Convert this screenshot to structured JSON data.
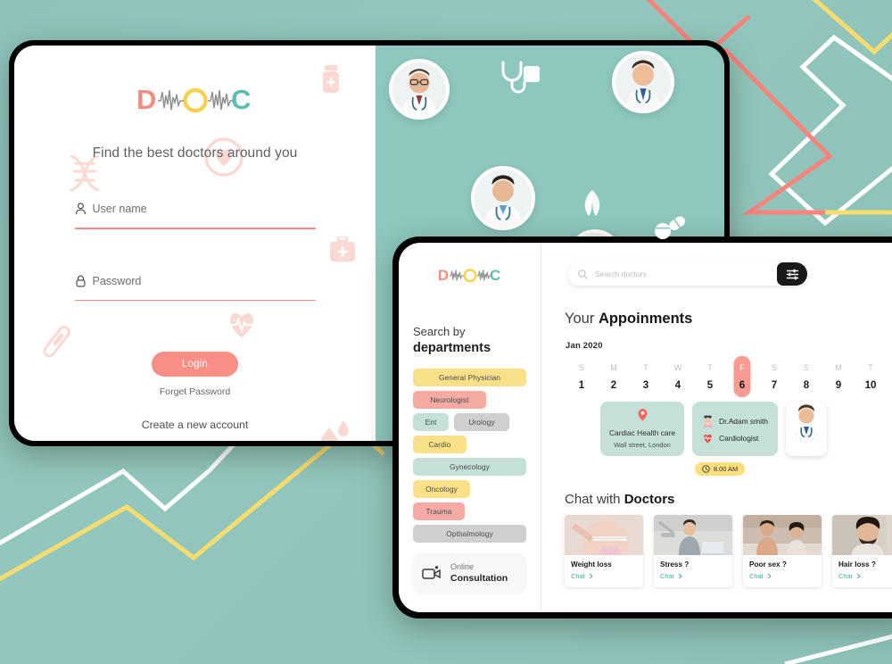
{
  "brand": {
    "name": "DOC",
    "letters": [
      "D",
      "O",
      "C"
    ],
    "colors": {
      "d": "#f08e86",
      "o": "#f7d14e",
      "c": "#5fbfae",
      "wave": "#8d9093"
    }
  },
  "login": {
    "tagline": "Find the best doctors around you",
    "username": {
      "label": "User name",
      "value": "",
      "icon": "user-icon"
    },
    "password": {
      "label": "Password",
      "value": "",
      "icon": "lock-icon"
    },
    "login_button": "Login",
    "forget_password": "Forget Password",
    "create_account": "Create a new account",
    "accent_color": "#f98e85",
    "panel_color": "#8ec7bd",
    "decor_icons": [
      "pill-bottle-icon",
      "dna-icon",
      "heart-cross-icon",
      "first-aid-kit-icon",
      "heart-pulse-icon",
      "thermometer-icon",
      "blood-drop-icon"
    ],
    "teal_decor_icons": [
      "stethoscope-icon",
      "pills-icon",
      "leaf-icon"
    ]
  },
  "dashboard": {
    "sidebar": {
      "search_by": "Search by",
      "departments_label": "departments",
      "departments": [
        {
          "label": "General Physician",
          "color": "#fbe08a",
          "width": "full"
        },
        {
          "label": "Neurologist",
          "color": "#f6aaa4",
          "width": "wide"
        },
        {
          "label": "Ent",
          "color": "#c4e0d9",
          "width": "narrow"
        },
        {
          "label": "Urology",
          "color": "#cfcfcf",
          "width": "mid"
        },
        {
          "label": "Cardio",
          "color": "#fbe08a",
          "width": "mid"
        },
        {
          "label": "Gynecology",
          "color": "#c4e0d9",
          "width": "full"
        },
        {
          "label": "Oncology",
          "color": "#fbe08a",
          "width": "mid"
        },
        {
          "label": "Trauma",
          "color": "#f6aaa4",
          "width": "mid"
        },
        {
          "label": "Opthalmology",
          "color": "#cfcfcf",
          "width": "full"
        }
      ],
      "online_consultation": {
        "line1": "Online",
        "line2": "Consultation",
        "icon": "video-camera-icon"
      }
    },
    "search": {
      "placeholder": "Search doctors",
      "value": "",
      "icon": "search-icon",
      "filter_icon": "filter-sliders-icon",
      "filter_bg": "#17191b"
    },
    "appointments": {
      "title_light": "Your ",
      "title_bold": "Appoinments",
      "month": "Jan 2020",
      "days": [
        {
          "dow": "S",
          "num": "1",
          "active": false
        },
        {
          "dow": "M",
          "num": "2",
          "active": false
        },
        {
          "dow": "T",
          "num": "3",
          "active": false
        },
        {
          "dow": "W",
          "num": "4",
          "active": false
        },
        {
          "dow": "T",
          "num": "5",
          "active": false
        },
        {
          "dow": "F",
          "num": "6",
          "active": true
        },
        {
          "dow": "S",
          "num": "7",
          "active": false
        },
        {
          "dow": "S",
          "num": "8",
          "active": false
        },
        {
          "dow": "M",
          "num": "9",
          "active": false
        },
        {
          "dow": "T",
          "num": "10",
          "active": false
        }
      ],
      "active_color": "#f99b92",
      "clinic": {
        "name": "Cardiac Health care",
        "address": "Wall street, London",
        "icon": "location-pin-icon"
      },
      "doctor": {
        "name": "Dr.Adam smith",
        "specialty": "Cardiologist",
        "name_icon": "doctor-avatar-icon",
        "specialty_icon": "heart-icon",
        "photo": "doctor-photo"
      },
      "time": {
        "label": "8.00 AM",
        "icon": "clock-icon",
        "bg": "#fbdf7e"
      }
    },
    "chat": {
      "title_light": "Chat with ",
      "title_bold": "Doctors",
      "link_label": "Chat",
      "link_icon": "chevron-right-icon",
      "cards": [
        {
          "label": "Weight loss",
          "image": "weight-loss-photo"
        },
        {
          "label": "Stress ?",
          "image": "stress-photo"
        },
        {
          "label": "Poor sex ?",
          "image": "poor-sex-photo"
        },
        {
          "label": "Hair loss ?",
          "image": "hair-loss-photo"
        }
      ]
    }
  },
  "background": {
    "color": "#8ec3ba",
    "line_colors": {
      "white": "#ffffff",
      "yellow": "#f7dd6f",
      "coral": "#f9847c"
    }
  }
}
